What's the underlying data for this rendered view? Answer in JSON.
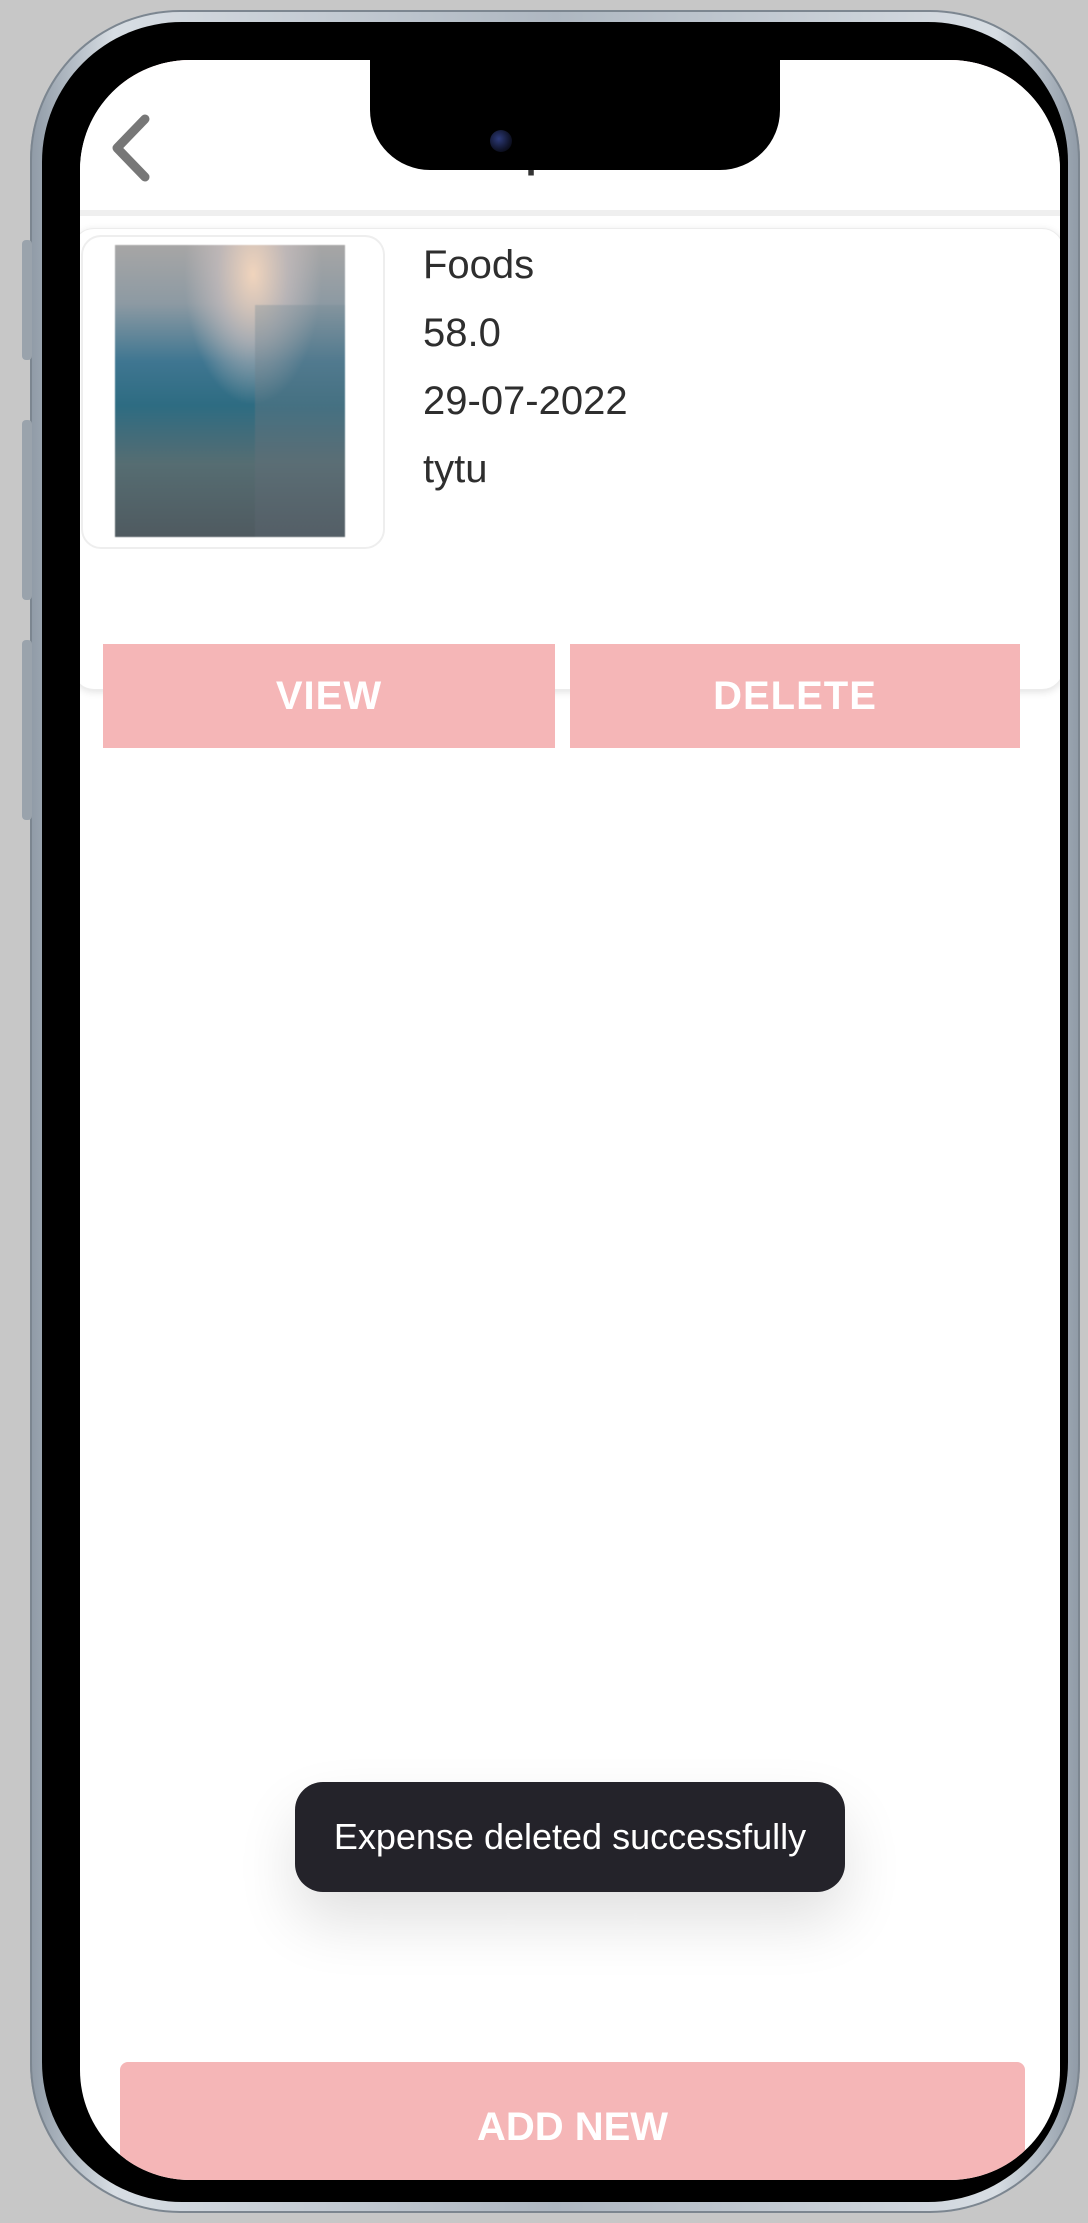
{
  "header": {
    "title": "Expenses",
    "back_icon": "chevron-left-icon"
  },
  "expense_list": [
    {
      "category": "Foods",
      "amount": "58.0",
      "date": "29-07-2022",
      "note": "tytu",
      "view_label": "VIEW",
      "delete_label": "DELETE"
    }
  ],
  "toast": {
    "message": "Expense deleted successfully"
  },
  "footer": {
    "add_new_label": "ADD NEW"
  },
  "colors": {
    "accent": "#F5B6B7",
    "toast_bg": "#24232A",
    "text": "#2E2E2E"
  }
}
